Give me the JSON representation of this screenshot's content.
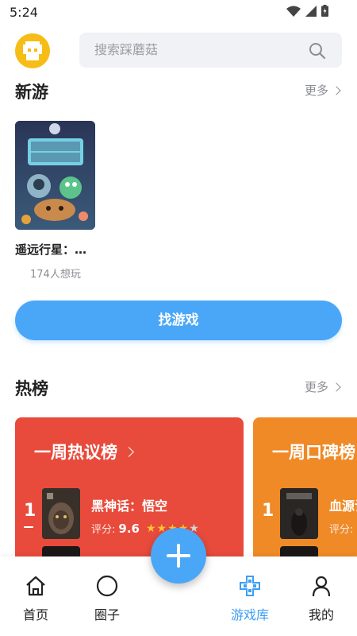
{
  "status_bar": {
    "time": "5:24"
  },
  "search": {
    "placeholder": "搜索踩蘑菇"
  },
  "new_games": {
    "title": "新游",
    "more": "更多",
    "items": [
      {
        "name": "遥远行星：…",
        "want": "174人想玩"
      }
    ]
  },
  "find_button": {
    "label": "找游戏"
  },
  "hot": {
    "title": "热榜",
    "more": "更多",
    "cards": [
      {
        "title": "一周热议榜",
        "top": {
          "rank": "1",
          "name": "黑神话：悟空",
          "score_label": "评分:",
          "score": "9.6",
          "stars": 4
        }
      },
      {
        "title": "一周口碑榜",
        "top": {
          "rank": "1",
          "name": "血源诅",
          "score_label": "评分:"
        }
      }
    ]
  },
  "colors": {
    "accent": "#4aa7f7",
    "hot_card": "#e84b3c",
    "praise_card": "#ef8a26",
    "star": "#ffc533"
  },
  "bottom_nav": {
    "items": [
      {
        "label": "首页",
        "icon": "home-icon"
      },
      {
        "label": "圈子",
        "icon": "circle-icon"
      },
      {
        "label": "游戏库",
        "icon": "gamepad-icon",
        "active": true
      },
      {
        "label": "我的",
        "icon": "person-icon"
      }
    ]
  }
}
